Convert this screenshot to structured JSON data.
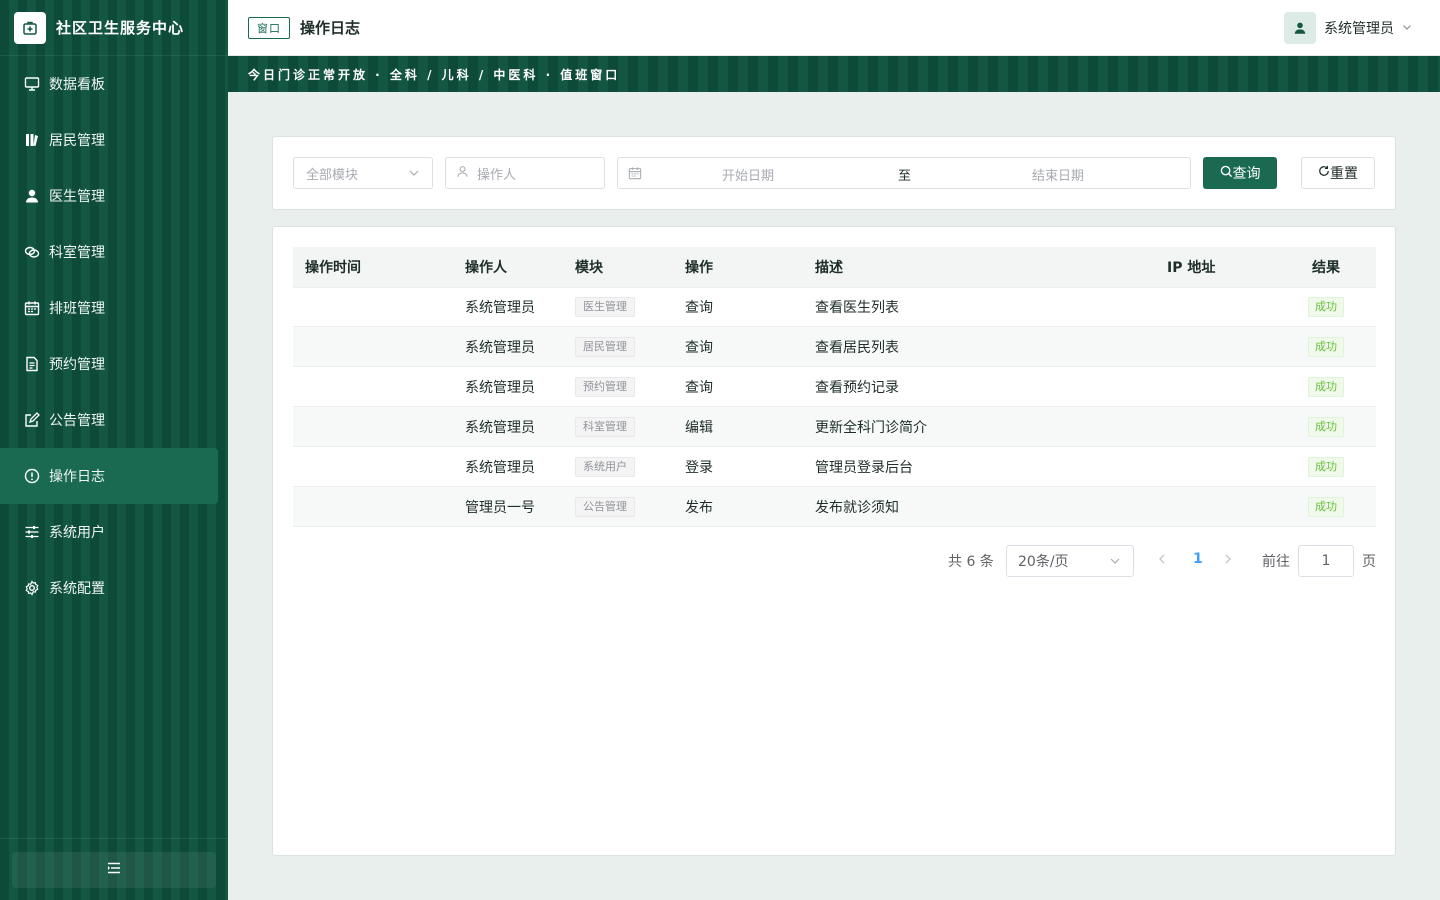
{
  "app": {
    "title": "社区卫生服务中心"
  },
  "sidebar": {
    "items": [
      {
        "label": "数据看板",
        "icon": "monitor-icon"
      },
      {
        "label": "居民管理",
        "icon": "residents-icon"
      },
      {
        "label": "医生管理",
        "icon": "user-icon"
      },
      {
        "label": "科室管理",
        "icon": "link-icon"
      },
      {
        "label": "排班管理",
        "icon": "calendar-icon"
      },
      {
        "label": "预约管理",
        "icon": "document-icon"
      },
      {
        "label": "公告管理",
        "icon": "edit-icon"
      },
      {
        "label": "操作日志",
        "icon": "info-circle-icon",
        "active": true
      },
      {
        "label": "系统用户",
        "icon": "sliders-icon"
      },
      {
        "label": "系统配置",
        "icon": "gear-icon"
      }
    ]
  },
  "header": {
    "tag": "窗口",
    "title": "操作日志",
    "user_name": "系统管理员"
  },
  "banner": {
    "text": "今日门诊正常开放 · 全科 / 儿科 / 中医科 · 值班窗口"
  },
  "filters": {
    "module_placeholder": "全部模块",
    "operator_placeholder": "操作人",
    "start_placeholder": "开始日期",
    "range_separator": "至",
    "end_placeholder": "结束日期",
    "query_label": "查询",
    "reset_label": "重置"
  },
  "table": {
    "columns": [
      "操作时间",
      "操作人",
      "模块",
      "操作",
      "描述",
      "IP 地址",
      "结果"
    ],
    "rows": [
      {
        "time": "",
        "operator": "系统管理员",
        "module": "医生管理",
        "action": "查询",
        "description": "查看医生列表",
        "ip": "",
        "result": "成功"
      },
      {
        "time": "",
        "operator": "系统管理员",
        "module": "居民管理",
        "action": "查询",
        "description": "查看居民列表",
        "ip": "",
        "result": "成功"
      },
      {
        "time": "",
        "operator": "系统管理员",
        "module": "预约管理",
        "action": "查询",
        "description": "查看预约记录",
        "ip": "",
        "result": "成功"
      },
      {
        "time": "",
        "operator": "系统管理员",
        "module": "科室管理",
        "action": "编辑",
        "description": "更新全科门诊简介",
        "ip": "",
        "result": "成功"
      },
      {
        "time": "",
        "operator": "系统管理员",
        "module": "系统用户",
        "action": "登录",
        "description": "管理员登录后台",
        "ip": "",
        "result": "成功"
      },
      {
        "time": "",
        "operator": "管理员一号",
        "module": "公告管理",
        "action": "发布",
        "description": "发布就诊须知",
        "ip": "",
        "result": "成功"
      }
    ]
  },
  "pagination": {
    "total_text": "共 6 条",
    "page_size": "20条/页",
    "current_page": "1",
    "goto_label": "前往",
    "goto_value": "1",
    "page_unit": "页"
  },
  "colors": {
    "primary": "#1a6a52",
    "sidebar": "#0e4a39",
    "success": "#67c23a",
    "link": "#409eff"
  }
}
